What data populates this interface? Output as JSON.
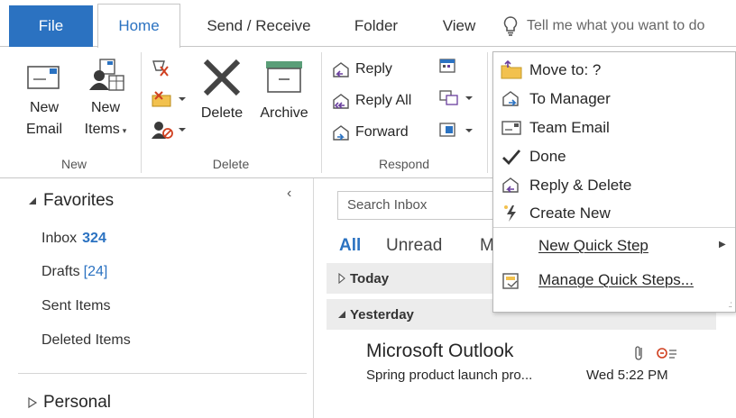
{
  "tabs": {
    "file": "File",
    "home": "Home",
    "send_receive": "Send / Receive",
    "folder": "Folder",
    "view": "View",
    "tell_me": "Tell me what you want to do"
  },
  "ribbon": {
    "new_group": {
      "label": "New",
      "new_email_line1": "New",
      "new_email_line2": "Email",
      "new_items_line1": "New",
      "new_items_line2": "Items"
    },
    "delete_group": {
      "label": "Delete",
      "delete": "Delete",
      "archive": "Archive"
    },
    "respond_group": {
      "label": "Respond",
      "reply": "Reply",
      "reply_all": "Reply All",
      "forward": "Forward"
    }
  },
  "quick_steps": {
    "items": [
      {
        "label": "Move to: ?",
        "icon": "folder-move-icon"
      },
      {
        "label": "To Manager",
        "icon": "forward-manager-icon"
      },
      {
        "label": "Team Email",
        "icon": "team-email-icon"
      },
      {
        "label": "Done",
        "icon": "checkmark-icon"
      },
      {
        "label": "Reply & Delete",
        "icon": "reply-delete-icon"
      },
      {
        "label": "Create New",
        "icon": "lightning-icon"
      }
    ],
    "new_quick_step": "New Quick Step",
    "manage_quick_steps": "Manage Quick Steps..."
  },
  "folders": {
    "favorites_header": "Favorites",
    "inbox": "Inbox",
    "inbox_count": "324",
    "drafts": "Drafts",
    "drafts_count": "[24]",
    "sent_items": "Sent Items",
    "deleted_items": "Deleted Items",
    "personal": "Personal"
  },
  "mail_list": {
    "search_placeholder": "Search Inbox",
    "filter_all": "All",
    "filter_unread": "Unread",
    "filter_more": "M",
    "group_today": "Today",
    "group_yesterday": "Yesterday",
    "message": {
      "sender": "Microsoft Outlook",
      "subject": "Spring product launch pro...",
      "time": "Wed 5:22 PM"
    }
  },
  "colors": {
    "accent": "#2b72c1",
    "group_row_bg": "#ececec"
  }
}
